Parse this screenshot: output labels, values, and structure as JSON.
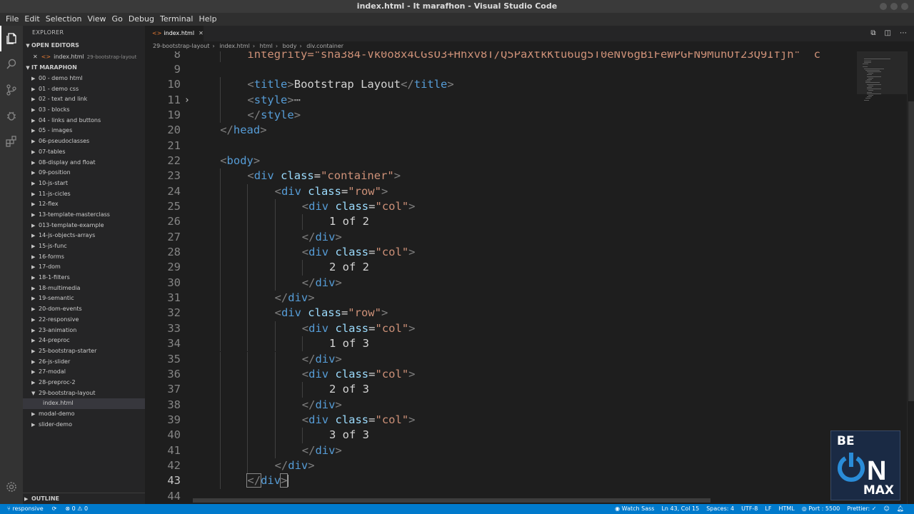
{
  "window": {
    "title": "index.html - It marafhon - Visual Studio Code"
  },
  "menu": [
    "File",
    "Edit",
    "Selection",
    "View",
    "Go",
    "Debug",
    "Terminal",
    "Help"
  ],
  "sidebar": {
    "title": "EXPLORER",
    "open_editors_label": "OPEN EDITORS",
    "open_editor": {
      "name": "index.html",
      "path": "29-bootstrap-layout"
    },
    "project_label": "IT MARAPHON",
    "folders": [
      "00 - demo html",
      "01 - demo css",
      "02 - text and link",
      "03 - blocks",
      "04 - links and buttons",
      "05 - images",
      "06-pseudoclasses",
      "07-tables",
      "08-display and float",
      "09-position",
      "10-js-start",
      "11-js-cicles",
      "12-flex",
      "13-template-masterclass",
      "013-template-example",
      "14-js-objects-arrays",
      "15-js-func",
      "16-forms",
      "17-dom",
      "18-1-filters",
      "18-multimedia",
      "19-semantic",
      "20-dom-events",
      "22-responsive",
      "23-animation",
      "24-preproc",
      "25-bootstrap-starter",
      "26-js-slider",
      "27-modal",
      "28-preproc-2",
      "29-bootstrap-layout"
    ],
    "selected_file": "index.html",
    "after_folders": [
      "modal-demo",
      "slider-demo"
    ],
    "outline_label": "OUTLINE"
  },
  "tab": {
    "label": "index.html"
  },
  "breadcrumbs": [
    "29-bootstrap-layout",
    "index.html",
    "html",
    "body",
    "div.container"
  ],
  "code": {
    "partial_top": "integrity=\"sha384-Vk0o8x4CGsO3+Hhxv8T/Q5PaXtkKtu6ug5T0eNV6gBiFeWPGFN9MuhOf23Q9Ifjh\"  c",
    "lines": [
      {
        "n": "8",
        "indent": 2,
        "tokens": []
      },
      {
        "n": "9",
        "indent": 0,
        "tokens": []
      },
      {
        "n": "10",
        "indent": 2,
        "tokens": [
          [
            "punc",
            "<"
          ],
          [
            "tag",
            "title"
          ],
          [
            "punc",
            ">"
          ],
          [
            "text",
            "Bootstrap Layout"
          ],
          [
            "punc",
            "</"
          ],
          [
            "tag",
            "title"
          ],
          [
            "punc",
            ">"
          ]
        ]
      },
      {
        "n": "11",
        "indent": 2,
        "fold": true,
        "tokens": [
          [
            "punc",
            "<"
          ],
          [
            "tag",
            "style"
          ],
          [
            "punc",
            ">"
          ],
          [
            "ell",
            "⋯"
          ]
        ]
      },
      {
        "n": "19",
        "indent": 2,
        "tokens": [
          [
            "punc",
            "</"
          ],
          [
            "tag",
            "style"
          ],
          [
            "punc",
            ">"
          ]
        ]
      },
      {
        "n": "20",
        "indent": 1,
        "tokens": [
          [
            "punc",
            "</"
          ],
          [
            "tag",
            "head"
          ],
          [
            "punc",
            ">"
          ]
        ]
      },
      {
        "n": "21",
        "indent": 0,
        "tokens": []
      },
      {
        "n": "22",
        "indent": 1,
        "tokens": [
          [
            "punc",
            "<"
          ],
          [
            "tag",
            "body"
          ],
          [
            "punc",
            ">"
          ]
        ]
      },
      {
        "n": "23",
        "indent": 2,
        "tokens": [
          [
            "punc",
            "<"
          ],
          [
            "tag",
            "div"
          ],
          [
            "text",
            " "
          ],
          [
            "attr",
            "class"
          ],
          [
            "text",
            "="
          ],
          [
            "str",
            "\"container\""
          ],
          [
            "punc",
            ">"
          ]
        ]
      },
      {
        "n": "24",
        "indent": 3,
        "tokens": [
          [
            "punc",
            "<"
          ],
          [
            "tag",
            "div"
          ],
          [
            "text",
            " "
          ],
          [
            "attr",
            "class"
          ],
          [
            "text",
            "="
          ],
          [
            "str",
            "\"row\""
          ],
          [
            "punc",
            ">"
          ]
        ]
      },
      {
        "n": "25",
        "indent": 4,
        "tokens": [
          [
            "punc",
            "<"
          ],
          [
            "tag",
            "div"
          ],
          [
            "text",
            " "
          ],
          [
            "attr",
            "class"
          ],
          [
            "text",
            "="
          ],
          [
            "str",
            "\"col\""
          ],
          [
            "punc",
            ">"
          ]
        ]
      },
      {
        "n": "26",
        "indent": 5,
        "tokens": [
          [
            "text",
            "1 of 2"
          ]
        ]
      },
      {
        "n": "27",
        "indent": 4,
        "tokens": [
          [
            "punc",
            "</"
          ],
          [
            "tag",
            "div"
          ],
          [
            "punc",
            ">"
          ]
        ]
      },
      {
        "n": "28",
        "indent": 4,
        "tokens": [
          [
            "punc",
            "<"
          ],
          [
            "tag",
            "div"
          ],
          [
            "text",
            " "
          ],
          [
            "attr",
            "class"
          ],
          [
            "text",
            "="
          ],
          [
            "str",
            "\"col\""
          ],
          [
            "punc",
            ">"
          ]
        ]
      },
      {
        "n": "29",
        "indent": 5,
        "tokens": [
          [
            "text",
            "2 of 2"
          ]
        ]
      },
      {
        "n": "30",
        "indent": 4,
        "tokens": [
          [
            "punc",
            "</"
          ],
          [
            "tag",
            "div"
          ],
          [
            "punc",
            ">"
          ]
        ]
      },
      {
        "n": "31",
        "indent": 3,
        "tokens": [
          [
            "punc",
            "</"
          ],
          [
            "tag",
            "div"
          ],
          [
            "punc",
            ">"
          ]
        ]
      },
      {
        "n": "32",
        "indent": 3,
        "tokens": [
          [
            "punc",
            "<"
          ],
          [
            "tag",
            "div"
          ],
          [
            "text",
            " "
          ],
          [
            "attr",
            "class"
          ],
          [
            "text",
            "="
          ],
          [
            "str",
            "\"row\""
          ],
          [
            "punc",
            ">"
          ]
        ]
      },
      {
        "n": "33",
        "indent": 4,
        "tokens": [
          [
            "punc",
            "<"
          ],
          [
            "tag",
            "div"
          ],
          [
            "text",
            " "
          ],
          [
            "attr",
            "class"
          ],
          [
            "text",
            "="
          ],
          [
            "str",
            "\"col\""
          ],
          [
            "punc",
            ">"
          ]
        ]
      },
      {
        "n": "34",
        "indent": 5,
        "tokens": [
          [
            "text",
            "1 of 3"
          ]
        ]
      },
      {
        "n": "35",
        "indent": 4,
        "tokens": [
          [
            "punc",
            "</"
          ],
          [
            "tag",
            "div"
          ],
          [
            "punc",
            ">"
          ]
        ]
      },
      {
        "n": "36",
        "indent": 4,
        "tokens": [
          [
            "punc",
            "<"
          ],
          [
            "tag",
            "div"
          ],
          [
            "text",
            " "
          ],
          [
            "attr",
            "class"
          ],
          [
            "text",
            "="
          ],
          [
            "str",
            "\"col\""
          ],
          [
            "punc",
            ">"
          ]
        ]
      },
      {
        "n": "37",
        "indent": 5,
        "tokens": [
          [
            "text",
            "2 of 3"
          ]
        ]
      },
      {
        "n": "38",
        "indent": 4,
        "tokens": [
          [
            "punc",
            "</"
          ],
          [
            "tag",
            "div"
          ],
          [
            "punc",
            ">"
          ]
        ]
      },
      {
        "n": "39",
        "indent": 4,
        "tokens": [
          [
            "punc",
            "<"
          ],
          [
            "tag",
            "div"
          ],
          [
            "text",
            " "
          ],
          [
            "attr",
            "class"
          ],
          [
            "text",
            "="
          ],
          [
            "str",
            "\"col\""
          ],
          [
            "punc",
            ">"
          ]
        ]
      },
      {
        "n": "40",
        "indent": 5,
        "tokens": [
          [
            "text",
            "3 of 3"
          ]
        ]
      },
      {
        "n": "41",
        "indent": 4,
        "tokens": [
          [
            "punc",
            "</"
          ],
          [
            "tag",
            "div"
          ],
          [
            "punc",
            ">"
          ]
        ]
      },
      {
        "n": "42",
        "indent": 3,
        "tokens": [
          [
            "punc",
            "</"
          ],
          [
            "tag",
            "div"
          ],
          [
            "punc",
            ">"
          ]
        ]
      },
      {
        "n": "43",
        "indent": 2,
        "current": true,
        "tokens": [
          [
            "punc",
            "</"
          ],
          [
            "tag",
            "div"
          ],
          [
            "punc",
            ">"
          ]
        ]
      },
      {
        "n": "44",
        "indent": 0,
        "tokens": []
      }
    ]
  },
  "statusbar": {
    "branch": "responsive",
    "problems": "⊗ 0 ⚠ 0",
    "watch_sass": "Watch Sass",
    "cursor": "Ln 43, Col 15",
    "spaces": "Spaces: 4",
    "encoding": "UTF-8",
    "eol": "LF",
    "language": "HTML",
    "port": "Port : 5500",
    "prettier": "Prettier: ✓"
  },
  "watermark": {
    "top": "BE",
    "middle": "ON",
    "bottom": "MAX"
  },
  "colors": {
    "statusbar": "#007acc",
    "tag": "#569cd6",
    "attr": "#9cdcfe",
    "string": "#ce9178",
    "text": "#d4d4d4"
  }
}
